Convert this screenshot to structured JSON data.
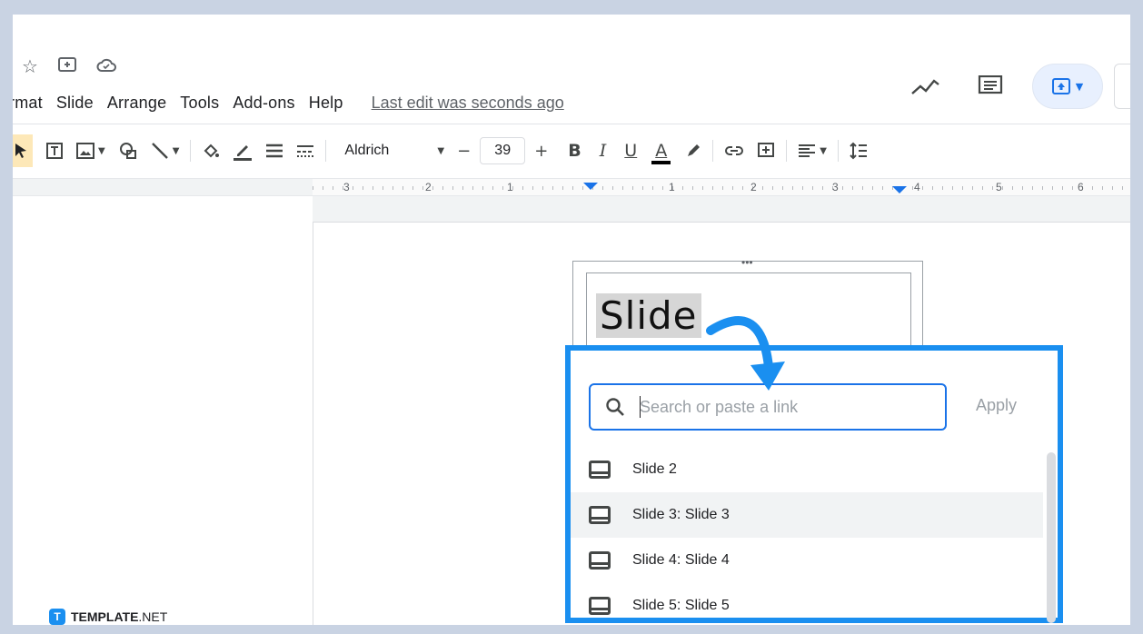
{
  "header": {
    "icons": [
      "star-icon",
      "move-folder-icon",
      "cloud-status-icon"
    ],
    "menu": [
      "rmat",
      "Slide",
      "Arrange",
      "Tools",
      "Add-ons",
      "Help"
    ],
    "last_edit": "Last edit was seconds ago",
    "right_icons": [
      "activity-trend-icon",
      "comments-icon",
      "present-icon"
    ]
  },
  "toolbar": {
    "font_name": "Aldrich",
    "font_size": "39",
    "minus": "−",
    "plus": "+",
    "bold": "B",
    "italic": "I",
    "underline": "U",
    "text_color": "A"
  },
  "ruler": {
    "labels": [
      "3",
      "2",
      "1",
      "1",
      "2",
      "3",
      "4",
      "5",
      "6"
    ]
  },
  "slide": {
    "text": "Slide"
  },
  "link_popup": {
    "search_placeholder": "Search or paste a link",
    "apply_label": "Apply",
    "items": [
      "Slide 2",
      "Slide 3: Slide 3",
      "Slide 4: Slide 4",
      "Slide 5: Slide 5"
    ]
  },
  "brand": {
    "mark": "T",
    "name_bold": "TEMPLATE",
    "name_rest": ".NET"
  },
  "colors": {
    "accent": "#1a73e8",
    "highlight_border": "#1a8ff0",
    "background": "#c9d3e3"
  }
}
